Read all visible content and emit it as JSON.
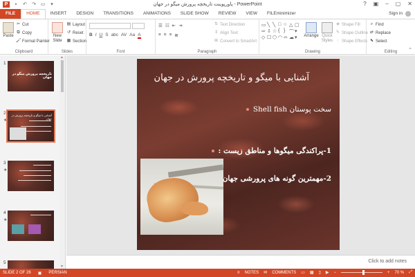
{
  "app": {
    "window_title": "پاورپوینت تاریخچه پرورش میگو در جهان - PowerPoint",
    "help": "?",
    "sign_in": "Sign in"
  },
  "tabs": [
    "FILE",
    "HOME",
    "INSERT",
    "DESIGN",
    "TRANSITIONS",
    "ANIMATIONS",
    "SLIDE SHOW",
    "REVIEW",
    "VIEW",
    "FILEminimizer"
  ],
  "active_tab": "HOME",
  "ribbon": {
    "clipboard": {
      "paste": "Paste",
      "cut": "Cut",
      "copy": "Copy",
      "format_painter": "Format Painter",
      "label": "Clipboard"
    },
    "slides": {
      "new_slide": "New Slide",
      "layout": "Layout",
      "reset": "Reset",
      "section": "Section",
      "label": "Slides"
    },
    "font": {
      "label": "Font",
      "format_marks": [
        "B",
        "I",
        "U",
        "S",
        "abc",
        "AV",
        "Aa",
        "A"
      ]
    },
    "paragraph": {
      "text_direction": "Text Direction",
      "align_text": "Align Text",
      "convert_smartart": "Convert to SmartArt",
      "label": "Paragraph"
    },
    "drawing": {
      "arrange": "Arrange",
      "quick_styles": "Quick Styles",
      "shape_fill": "Shape Fill",
      "shape_outline": "Shape Outline",
      "shape_effects": "Shape Effects",
      "label": "Drawing"
    },
    "editing": {
      "find": "Find",
      "replace": "Replace",
      "select": "Select",
      "label": "Editing"
    }
  },
  "thumbnails": [
    {
      "num": "1",
      "text": "تاریخچه پرورش میگو در جهان",
      "star": false
    },
    {
      "num": "2",
      "text": "آشنایی با میگو و تاریخچه پرورش در جهان",
      "star": true
    },
    {
      "num": "3",
      "text": "",
      "star": true
    },
    {
      "num": "4",
      "text": "",
      "star": true
    },
    {
      "num": "5",
      "text": "",
      "star": false
    }
  ],
  "slide": {
    "title": "آشنایی با میگو و تاریخچه پرورش در جهان",
    "bullet1": "سخت پوستان Shell fish",
    "bullet2": "1-پراکندگی میگوها و مناطق زیست :",
    "bullet3": "2-مهمترین گونه های پرورشی جهان"
  },
  "notes_placeholder": "Click to add notes",
  "status": {
    "slide_info": "SLIDE 2 OF 26",
    "language": "PERSIAN",
    "notes": "NOTES",
    "comments": "COMMENTS",
    "zoom": "70 %",
    "zoom_level_fraction": 0.55
  },
  "colors": {
    "accent": "#d24726",
    "selected_outline": "#e37b59"
  }
}
